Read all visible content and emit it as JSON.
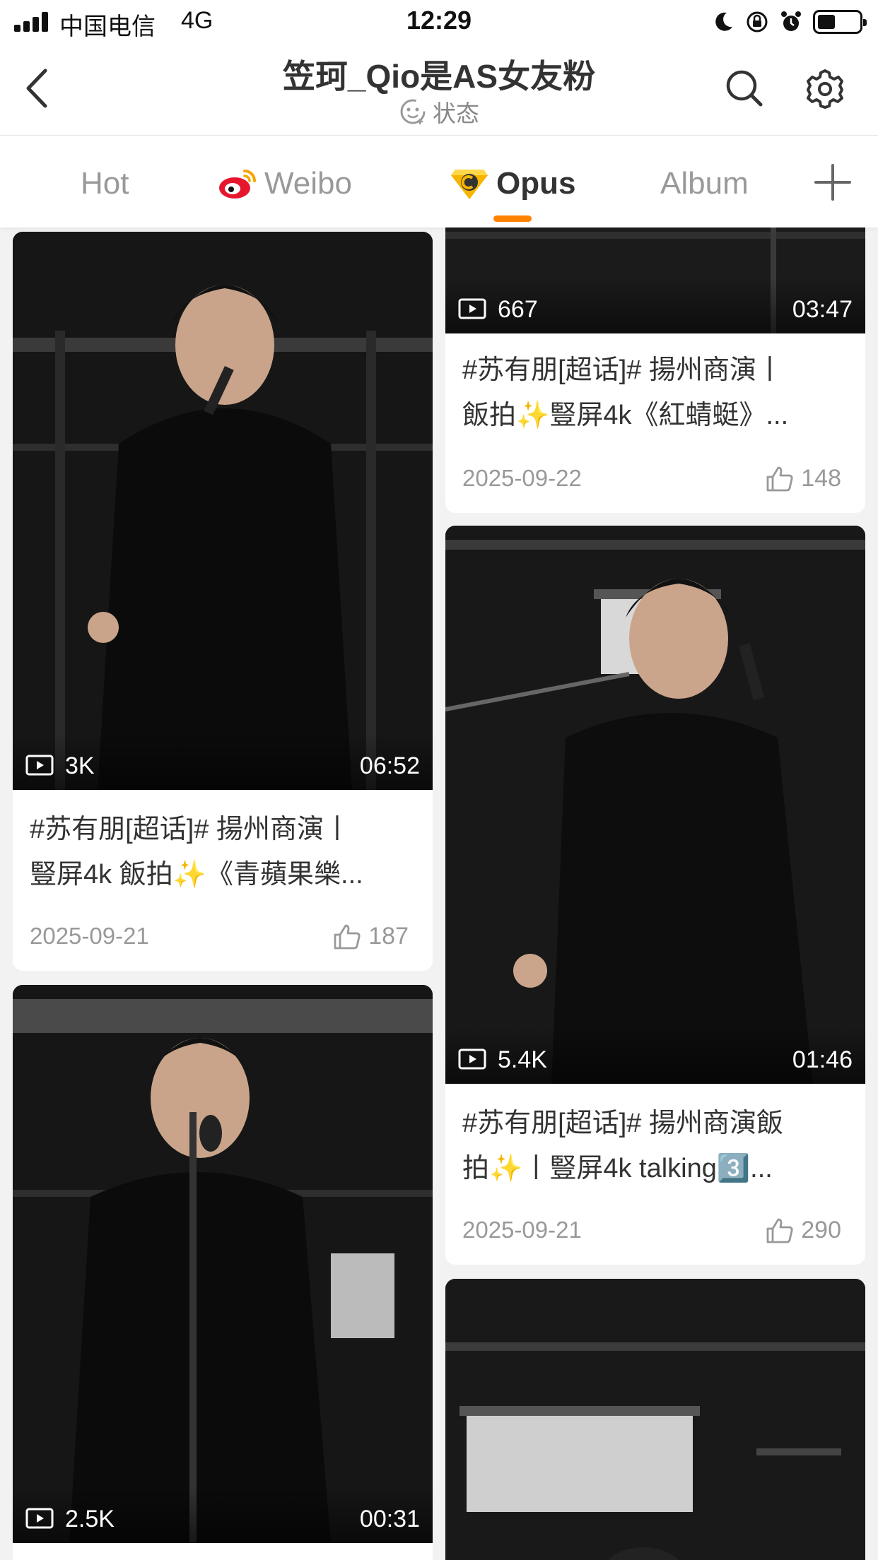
{
  "status_bar": {
    "carrier": "中国电信",
    "network": "4G",
    "time": "12:29"
  },
  "header": {
    "title": "笠珂_Qio是AS女友粉",
    "status_label": "状态"
  },
  "tabs": [
    {
      "label": "Hot"
    },
    {
      "label": "Weibo"
    },
    {
      "label": "Opus"
    },
    {
      "label": "Album"
    }
  ],
  "active_tab": "Opus",
  "accent_color": "#ff8200",
  "cards": [
    {
      "views": "3K",
      "duration": "06:52",
      "title_line1": "#苏有朋[超话]# 揚州商演丨",
      "title_line2": "豎屏4k 飯拍✨《青蘋果樂...",
      "date": "2025-09-21",
      "likes": "187"
    },
    {
      "views": "667",
      "duration": "03:47",
      "title_line1": "#苏有朋[超话]# 揚州商演丨",
      "title_line2": "飯拍✨豎屏4k《紅蜻蜓》...",
      "date": "2025-09-22",
      "likes": "148"
    },
    {
      "views": "5.4K",
      "duration": "01:46",
      "title_line1": "#苏有朋[超话]# 揚州商演飯",
      "title_line2": "拍✨丨豎屏4k talking3️⃣...",
      "date": "2025-09-21",
      "likes": "290"
    },
    {
      "views": "2.5K",
      "duration": "00:31"
    },
    {}
  ]
}
